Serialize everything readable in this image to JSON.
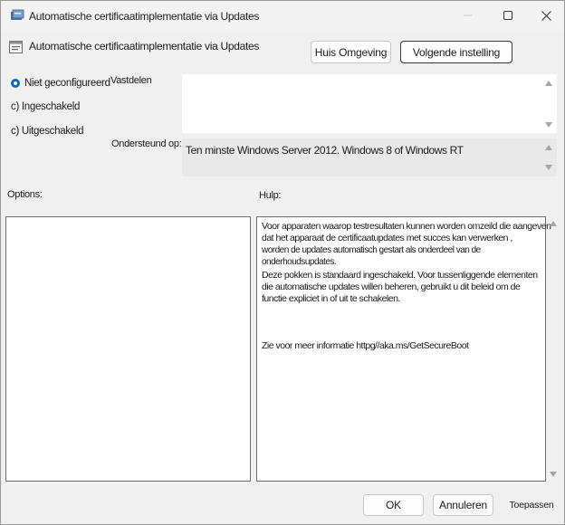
{
  "window": {
    "title": "Automatische certificaatimplementatie via Updates"
  },
  "header": {
    "title": "Automatische certificaatimplementatie via Updates",
    "prev_button": "Huis Omgeving",
    "next_button": "Volgende instelling"
  },
  "radios": {
    "not_configured": "Niet geconfigureerd",
    "enabled": "c) Ingeschakeld",
    "disabled": "c) Uitgeschakeld",
    "selected": "not_configured"
  },
  "comment": {
    "label": "Vastdelen",
    "value": ""
  },
  "supported": {
    "label": "Ondersteund op:",
    "value": "Ten minste Windows Server 2012. Windows 8 of Windows RT"
  },
  "options": {
    "label": "Options:"
  },
  "help": {
    "label": "Hulp:",
    "lines": [
      "Voor apparaten waarop testresultaten kunnen worden omzeild die aangeven",
      "dat het apparaat de certificaatupdates met succes kan verwerken ,",
      "worden de updates automatisch gestart als onderdeel van de onderhoudsupdates.",
      "Deze pokken is standaard ingeschakeld. Voor tussenliggende elementen",
      "die automatische updates willen beheren, gebruikt u dit beleid om de",
      "functie expliciet in of uit te schakelen."
    ],
    "more_info": "Zie voor meer informatie httpg//aka.ms/GetSecureBoot"
  },
  "footer": {
    "ok": "OK",
    "cancel": "Annuleren",
    "apply": "Toepassen"
  },
  "colors": {
    "accent": "#0f6cbd",
    "background": "#f0f0f0",
    "textbox": "#ffffff"
  }
}
